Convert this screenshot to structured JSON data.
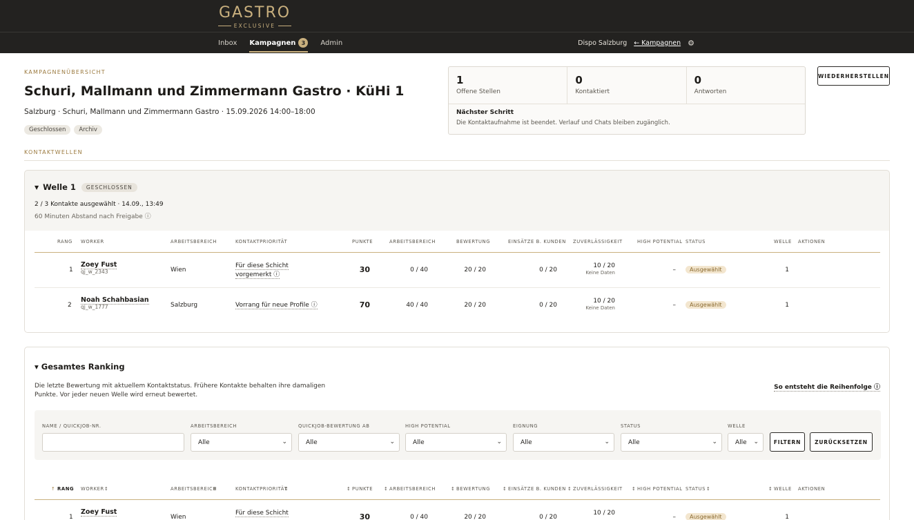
{
  "brand": {
    "name": "GASTRO",
    "sub": "EXCLUSIVE",
    "accent": "#c9b07e",
    "dark": "#232220"
  },
  "nav": {
    "inbox": "Inbox",
    "kampagnen": "Kampagnen",
    "kampagnen_badge": "3",
    "admin": "Admin",
    "location": "Dispo Salzburg",
    "back_link": "← Kampagnen",
    "settings_icon": "gear-icon"
  },
  "header": {
    "eyebrow": "KAMPAGNENÜBERSICHT",
    "title": "Schuri, Mallmann und Zimmermann Gastro · KüHi 1",
    "subline": "Salzburg · Schuri, Mallmann und Zimmermann Gastro · 15.09.2026 14:00–18:00",
    "tags": [
      "Geschlossen",
      "Archiv"
    ],
    "restore_button": "WIEDERHERSTELLEN"
  },
  "stats": {
    "items": [
      {
        "value": "1",
        "label": "Offene Stellen"
      },
      {
        "value": "0",
        "label": "Kontaktiert"
      },
      {
        "value": "0",
        "label": "Antworten"
      }
    ],
    "next_title": "Nächster Schritt",
    "next_text": "Die Kontaktaufnahme ist beendet. Verlauf und Chats bleiben zugänglich."
  },
  "section_label": "KONTAKTWELLEN",
  "welle": {
    "title": "Welle 1",
    "badge": "GESCHLOSSEN",
    "meta1": "2 / 3 Kontakte ausgewählt · 14.09., 13:49",
    "meta2": "60 Minuten Abstand nach Freigabe ⓘ",
    "headers": {
      "rang": "RANG",
      "worker": "WORKER",
      "arbeitsbereich": "ARBEITSBEREICH",
      "kontaktprio": "KONTAKTPRIORITÄT",
      "punkte": "PUNKTE",
      "arbeitsbereich2": "ARBEITSBEREICH",
      "bewertung": "BEWERTUNG",
      "einsaetze": "EINSÄTZE B. KUNDEN",
      "zuverl": "ZUVERLÄSSIGKEIT",
      "high": "HIGH POTENTIAL",
      "status": "STATUS",
      "welle": "WELLE",
      "aktionen": "AKTIONEN"
    },
    "rows": [
      {
        "rang": "1",
        "name": "Zoey Fust",
        "id": "qj_w_2343",
        "bereich": "Wien",
        "prio1": "Für diese Schicht",
        "prio2": "vorgemerkt ⓘ",
        "punkte": "30",
        "ab": "0 / 40",
        "bew": "20 / 20",
        "eins": "0 / 20",
        "zuv": "10 / 20",
        "zuv_note": "Keine Daten",
        "high": "–",
        "status": "Ausgewählt",
        "welle": "1"
      },
      {
        "rang": "2",
        "name": "Noah Schahbasian",
        "id": "qj_w_1777",
        "bereich": "Salzburg",
        "prio1": "Vorrang für neue Profile ⓘ",
        "prio2": "",
        "punkte": "70",
        "ab": "40 / 40",
        "bew": "20 / 20",
        "eins": "0 / 20",
        "zuv": "10 / 20",
        "zuv_note": "Keine Daten",
        "high": "–",
        "status": "Ausgewählt",
        "welle": "1"
      }
    ]
  },
  "ranking": {
    "title": "▾ Gesamtes Ranking",
    "desc": "Die letzte Bewertung mit aktuellem Kontaktstatus. Frühere Kontakte behalten ihre damaligen Punkte. Vor jeder neuen Welle wird erneut bewertet.",
    "link": "So entsteht die Reihenfolge ⓘ",
    "filters": {
      "name_label": "NAME / QUICKJOB-NR.",
      "name_value": "",
      "bereich_label": "ARBEITSBEREICH",
      "bereich_value": "Alle",
      "quickjob_label": "QUICKJOB-BEWERTUNG AB",
      "quickjob_value": "Alle",
      "high_label": "HIGH POTENTIAL",
      "high_value": "Alle",
      "eignung_label": "EIGNUNG",
      "eignung_value": "Alle",
      "status_label": "STATUS",
      "status_value": "Alle",
      "welle_label": "WELLE",
      "welle_value": "Alle",
      "filter_button": "FILTERN",
      "reset_button": "ZURÜCKSETZEN"
    },
    "headers": {
      "rang": "RANG",
      "worker": "WORKER",
      "arbeitsbereich": "ARBEITSBEREICH",
      "kontaktprio": "KONTAKTPRIORITÄT",
      "punkte": "PUNKTE",
      "arbeitsbereich2": "ARBEITSBEREICH",
      "bewertung": "BEWERTUNG",
      "einsaetze": "EINSÄTZE B. KUNDEN",
      "zuverl": "ZUVERLÄSSIGKEIT",
      "high": "HIGH POTENTIAL",
      "status": "STATUS",
      "welle": "WELLE",
      "aktionen": "AKTIONEN"
    },
    "first_row": {
      "rang": "1",
      "name": "Zoey Fust",
      "bereich": "Wien",
      "prio1": "Für diese Schicht",
      "punkte": "30",
      "ab": "0 / 40",
      "bew": "20 / 20",
      "eins": "0 / 20",
      "zuv": "10 / 20",
      "high": "–",
      "status": "Ausgewählt",
      "welle": "1"
    }
  }
}
